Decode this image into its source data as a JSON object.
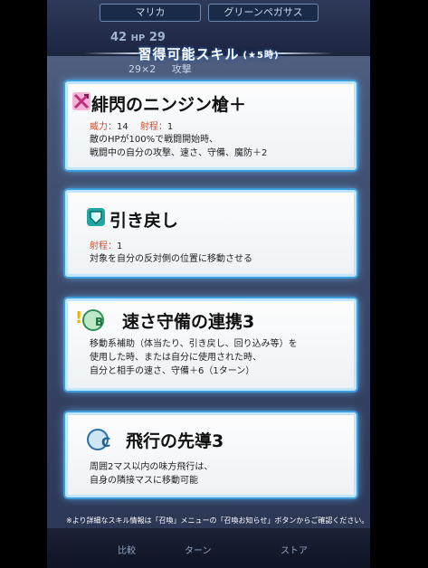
{
  "header": {
    "name_tab": "マリカ",
    "weapon_tab": "グリーンペガサス",
    "hp_value_left": "42",
    "hp_label": "HP",
    "hp_value_right": "29",
    "sub_stat": "29×2",
    "sub_label": "攻撃"
  },
  "panel_title": {
    "text": "習得可能スキル",
    "rank": "(★5時)"
  },
  "skills": [
    {
      "name": "緋閃のニンジン槍＋",
      "icon": "lance-icon",
      "might_label": "威力",
      "might_value": "14",
      "range_label": "射程",
      "range_value": "1",
      "desc_line1": "敵のHPが100%で戦闘開始時、",
      "desc_line2": "戦闘中の自分の攻撃、速さ、守備、魔防＋2"
    },
    {
      "name": "引き戻し",
      "icon": "shield-icon",
      "range_label": "射程",
      "range_value": "1",
      "desc_line1": "対象を自分の反対側の位置に移動させる"
    },
    {
      "name": "速さ守備の連携3",
      "icon": "b-skill-icon",
      "desc_line1": "移動系補助（体当たり、引き戻し、回り込み等）を",
      "desc_line2": "使用した時、または自分に使用された時、",
      "desc_line3": "自分と相手の速さ、守備＋6（1ターン）"
    },
    {
      "name": "飛行の先導3",
      "icon": "c-skill-icon",
      "desc_line1": "周囲2マス以内の味方飛行は、",
      "desc_line2": "自身の隣接マスに移動可能"
    }
  ],
  "footer_note": "※より詳細なスキル情報は「召喚」メニューの「召喚お知らせ」ボタンからご確認ください。",
  "bottom_bar": {
    "left": "比較",
    "mid": "ターン",
    "right": "ストア"
  },
  "colors": {
    "card_glow": "#62c2ff",
    "label_red": "#d04a2a"
  }
}
